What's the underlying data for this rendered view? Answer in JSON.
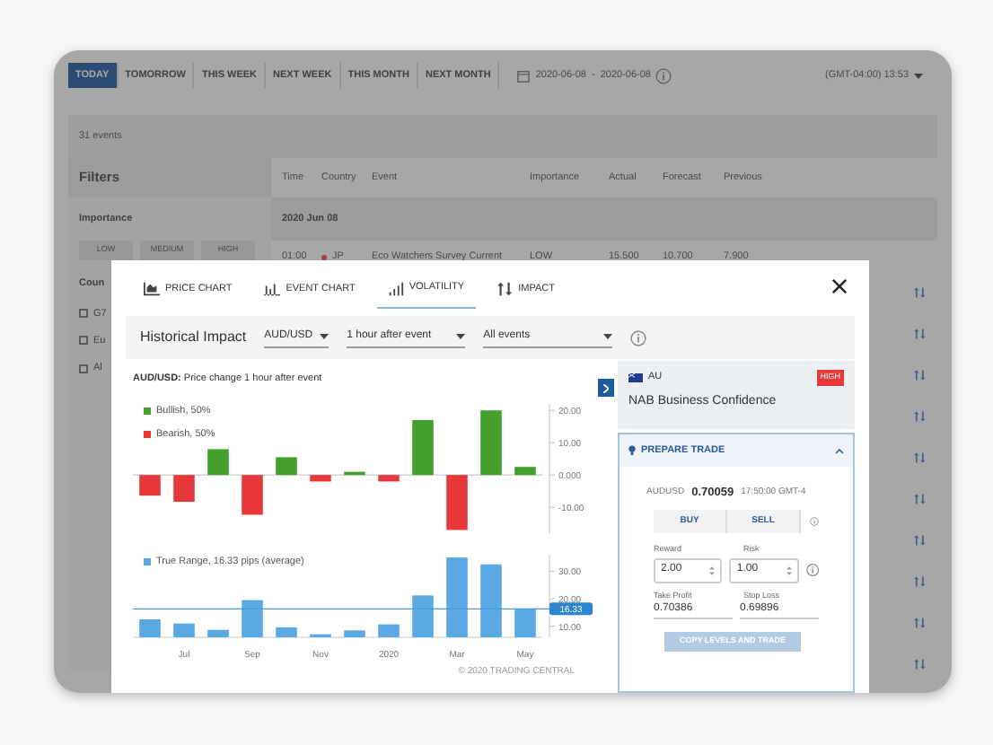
{
  "toolbar": {
    "periods": [
      {
        "label": "TODAY",
        "selected": true
      },
      {
        "label": "TOMORROW",
        "selected": false
      },
      {
        "label": "THIS WEEK",
        "selected": false
      },
      {
        "label": "NEXT WEEK",
        "selected": false
      },
      {
        "label": "THIS MONTH",
        "selected": false
      },
      {
        "label": "NEXT MONTH",
        "selected": false
      }
    ],
    "date_from": "2020-06-08",
    "date_separator": "-",
    "date_to": "2020-06-08",
    "timezone": "(GMT-04:00) 13:53"
  },
  "event_count": "31 events",
  "filters": {
    "title": "Filters",
    "importance_label": "Importance",
    "importance_options": [
      "LOW",
      "MEDIUM",
      "HIGH"
    ],
    "country_label": "Coun",
    "country_options": [
      {
        "label": "G7",
        "checked": false
      },
      {
        "label": "Eu",
        "checked": false
      },
      {
        "label": "Al",
        "checked": false
      }
    ]
  },
  "table": {
    "columns": [
      "Time",
      "Country",
      "Event",
      "Importance",
      "Actual",
      "Forecast",
      "Previous"
    ],
    "date_group": "2020 Jun 08",
    "rows": [
      {
        "time": "01:00",
        "color": "#a8413f",
        "country": "JP",
        "event": "Eco Watchers Survey Current",
        "importance": "LOW",
        "actual": "15.500",
        "forecast": "10.700",
        "previous": "7.900"
      }
    ]
  },
  "modal": {
    "tabs": [
      {
        "label": "PRICE CHART",
        "kind": "price",
        "selected": false
      },
      {
        "label": "EVENT CHART",
        "kind": "event",
        "selected": false
      },
      {
        "label": "VOLATILITY",
        "kind": "volatility",
        "selected": true
      },
      {
        "label": "IMPACT",
        "kind": "impact",
        "selected": false
      }
    ],
    "filters": {
      "title": "Historical Impact",
      "pair": "AUD/USD",
      "window": "1 hour after event",
      "events": "All events"
    },
    "chart_title": "**AUD/USD:** Price change 1 hour after event",
    "price_chart": {
      "chart_data": {
        "type": "bar",
        "stacked": true,
        "ylim": [
          -18,
          22
        ],
        "yticks": [
          {
            "value": 20,
            "label": "20.00"
          },
          {
            "value": 10,
            "label": "10.00"
          },
          {
            "value": 0,
            "label": "0.000"
          },
          {
            "value": -10,
            "label": "-10.00"
          }
        ],
        "series": [
          {
            "name": "Bullish, 50%",
            "color": "#43a02c",
            "values": [
              null,
              null,
              8,
              null,
              5.5,
              null,
              1,
              null,
              17,
              null,
              20,
              2.5
            ]
          },
          {
            "name": "Bearish, 50%",
            "color": "#e8383a",
            "values": [
              -6.4,
              -8.3,
              null,
              -12.3,
              null,
              -2,
              null,
              -2,
              null,
              -17,
              null,
              null
            ]
          }
        ]
      }
    },
    "range_chart": {
      "chart_data": {
        "type": "bar",
        "categories": [
          null,
          "Jul",
          null,
          "Sep",
          null,
          "Nov",
          null,
          "2020",
          null,
          "Mar",
          null,
          "May"
        ],
        "ylim": [
          6,
          36
        ],
        "yticks": [
          {
            "value": 30,
            "label": "30.00"
          },
          {
            "value": 20,
            "label": "20.00"
          },
          {
            "value": 10,
            "label": "10.00"
          }
        ],
        "series": [
          {
            "name": "True Range, 16.33 pips (average)",
            "color": "#5aa8e4",
            "values": [
              12.5,
              11,
              8.7,
              19.5,
              9.6,
              7.1,
              8.5,
              10.7,
              21.2,
              35,
              32.5,
              16.3
            ]
          }
        ],
        "ref_lines": [
          {
            "axis": "y",
            "value": 16.33,
            "label": "16.33"
          }
        ]
      }
    },
    "copyright": "© 2020 TRADING CENTRAL",
    "event": {
      "country": "AU",
      "importance": "HIGH",
      "name": "NAB Business Confidence"
    },
    "trade": {
      "title": "PREPARE TRADE",
      "expanded": true,
      "pair": "AUDUSD",
      "price": "0.70059",
      "time": "17:50:00 GMT-4",
      "buttons": [
        "BUY",
        "SELL"
      ],
      "reward_label": "Reward",
      "reward": "2.00",
      "risk_label": "Risk",
      "risk": "1.00",
      "take_profit_label": "Take Profit",
      "take_profit": "0.70386",
      "stop_loss_label": "Stop Loss",
      "stop_loss": "0.69896",
      "submit": {
        "label": "COPY LEVELS AND TRADE",
        "disabled": true
      }
    }
  }
}
